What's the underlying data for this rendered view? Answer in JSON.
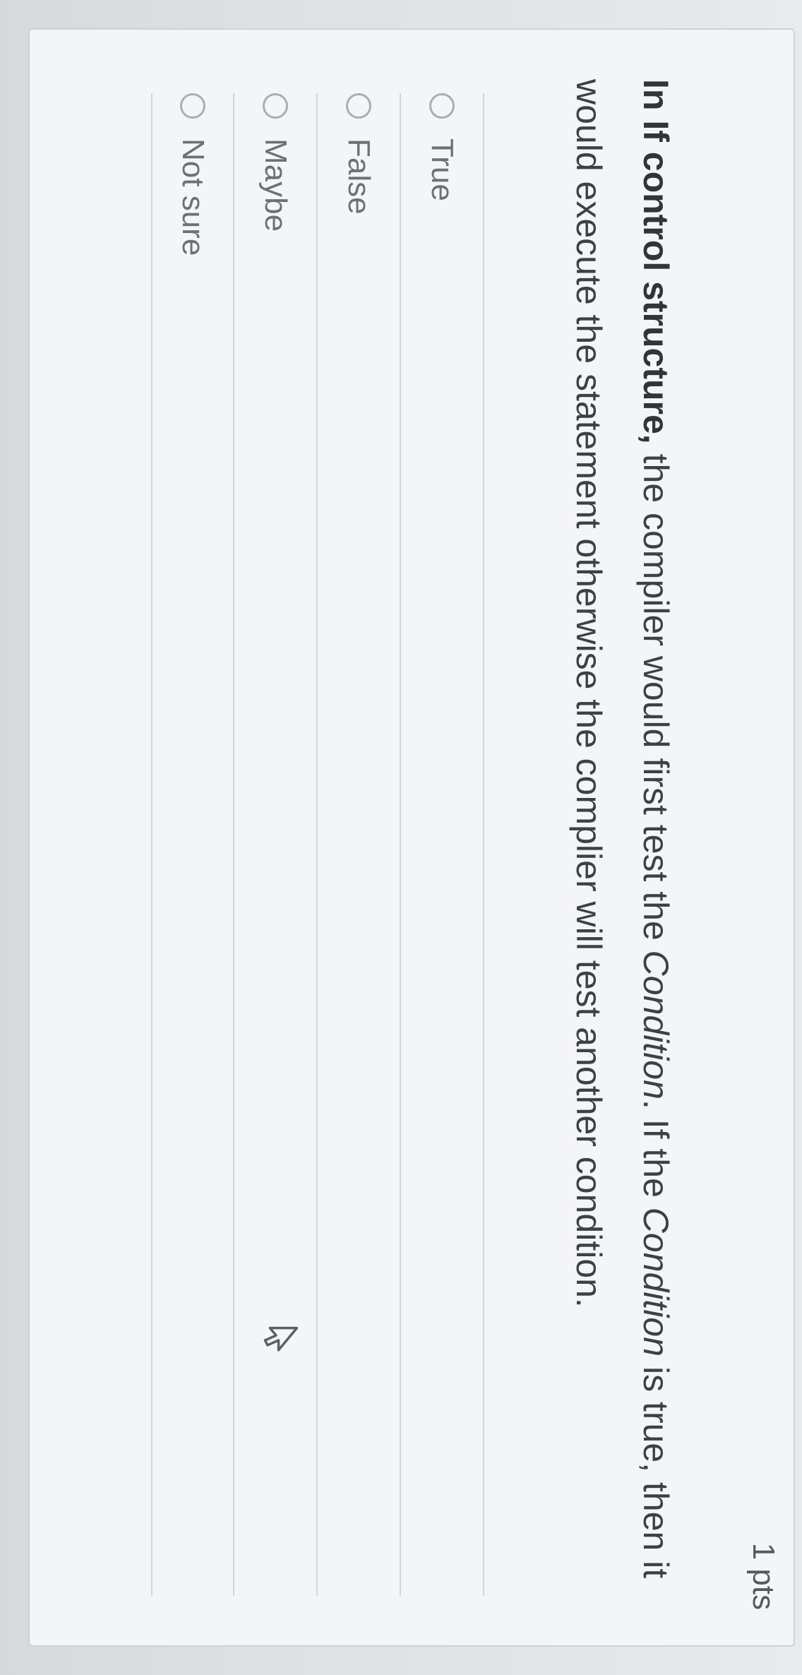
{
  "points": "1 pts",
  "question": {
    "leadBold": "In If control structure,",
    "part1": " the compiler would first test the ",
    "em1": "Condition",
    "part2": ". If the ",
    "em2": "Condition",
    "part3": " is true, then it would execute the statement otherwise the complier will test another condition."
  },
  "options": [
    {
      "label": "True"
    },
    {
      "label": "False"
    },
    {
      "label": "Maybe"
    },
    {
      "label": "Not sure"
    }
  ]
}
